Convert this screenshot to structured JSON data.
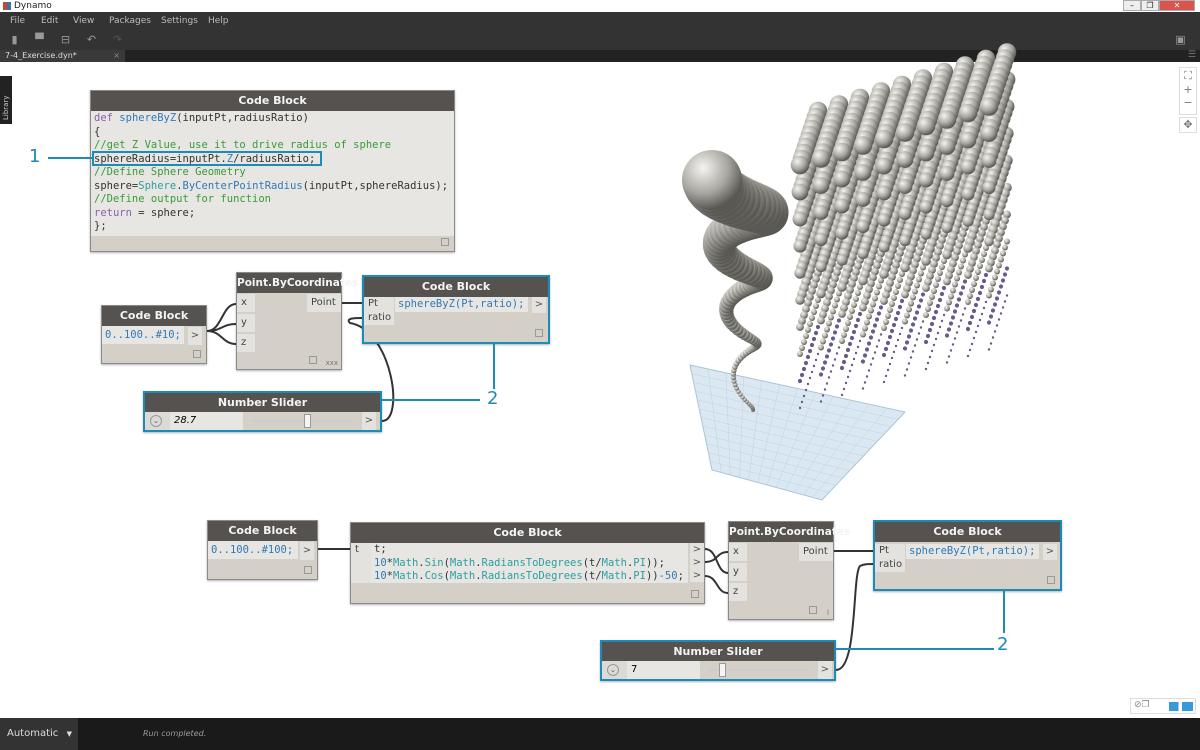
{
  "app": {
    "title": "Dynamo",
    "window_buttons": [
      "–",
      "❐",
      "✕"
    ]
  },
  "menu": [
    "File",
    "Edit",
    "View",
    "Packages",
    "Settings",
    "Help"
  ],
  "tab": {
    "label": "7-4_Exercise.dyn*",
    "close": "×"
  },
  "library_label": "Library",
  "nodes": {
    "def_block": {
      "title": "Code Block",
      "lines": [
        {
          "parts": [
            [
              "kw",
              "def "
            ],
            [
              "fn",
              "sphereByZ"
            ],
            [
              "",
              "(inputPt,radiusRatio)"
            ]
          ]
        },
        {
          "parts": [
            [
              "",
              "{"
            ]
          ]
        },
        {
          "parts": [
            [
              "cm",
              "//get Z Value, use it to drive radius of sphere"
            ]
          ]
        },
        {
          "parts": [
            [
              "",
              "sphereRadius=inputPt."
            ],
            [
              "fn",
              "Z"
            ],
            [
              "",
              "/radiusRatio;"
            ]
          ]
        },
        {
          "parts": [
            [
              "cm",
              "//Define Sphere Geometry"
            ]
          ]
        },
        {
          "parts": [
            [
              "",
              "sphere="
            ],
            [
              "cls",
              "Sphere"
            ],
            [
              "",
              "."
            ],
            [
              "fn",
              "ByCenterPointRadius"
            ],
            [
              "",
              "(inputPt,sphereRadius);"
            ]
          ]
        },
        {
          "parts": [
            [
              "cm",
              "//Define output for function"
            ]
          ]
        },
        {
          "parts": [
            [
              "kw",
              "return"
            ],
            [
              "",
              " = sphere;"
            ]
          ]
        },
        {
          "parts": [
            [
              "",
              "};"
            ]
          ]
        }
      ]
    },
    "range1": {
      "title": "Code Block",
      "code": "0..100..#10;",
      "out": ">"
    },
    "point1": {
      "title": "Point.ByCoordinates",
      "inputs": [
        "x",
        "y",
        "z"
      ],
      "output": "Point",
      "lacing": "xxx"
    },
    "call1": {
      "title": "Code Block",
      "inputs": [
        "Pt",
        "ratio"
      ],
      "code": "sphereByZ(Pt,ratio);",
      "out": ">"
    },
    "slider1": {
      "title": "Number Slider",
      "value": "28.7",
      "fraction": 0.55,
      "out": ">"
    },
    "range2": {
      "title": "Code Block",
      "code": "0..100..#100;",
      "out": ">"
    },
    "math": {
      "title": "Code Block",
      "input": "t",
      "lines": [
        "t;",
        "10*Math.Sin(Math.RadiansToDegrees(t/Math.PI));",
        "10*Math.Cos(Math.RadiansToDegrees(t/Math.PI))-50;"
      ],
      "out": ">"
    },
    "point2": {
      "title": "Point.ByCoordinates",
      "inputs": [
        "x",
        "y",
        "z"
      ],
      "output": "Point",
      "lacing": "l"
    },
    "call2": {
      "title": "Code Block",
      "inputs": [
        "Pt",
        "ratio"
      ],
      "code": "sphereByZ(Pt,ratio);",
      "out": ">"
    },
    "slider2": {
      "title": "Number Slider",
      "value": "7",
      "fraction": 0.12,
      "out": ">"
    }
  },
  "callouts": [
    "1",
    "2",
    "2"
  ],
  "run_mode": "Automatic",
  "status": "Run completed.",
  "colors": {
    "accent": "#1c8bb8",
    "header": "#555250",
    "node_body": "#d4d0c8"
  }
}
